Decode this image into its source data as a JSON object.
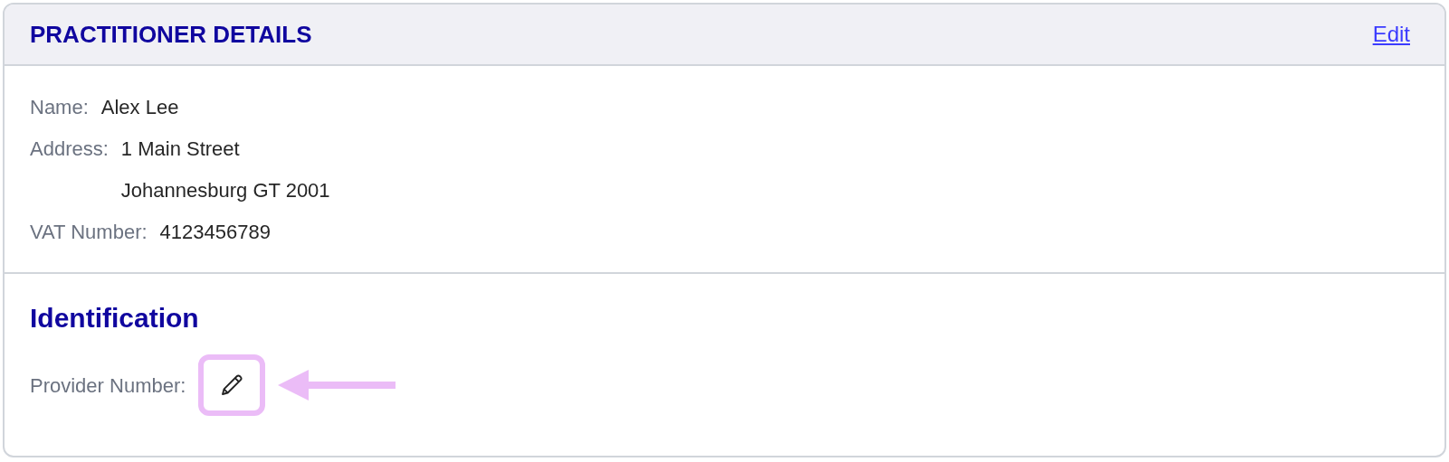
{
  "header": {
    "title": "PRACTITIONER DETAILS",
    "edit_link": "Edit"
  },
  "details": [
    {
      "label": "Name:",
      "lines": [
        "Alex Lee"
      ]
    },
    {
      "label": "Address:",
      "lines": [
        "1 Main Street",
        "Johannesburg GT 2001"
      ]
    },
    {
      "label": "VAT Number:",
      "lines": [
        "4123456789"
      ]
    }
  ],
  "identification": {
    "title": "Identification",
    "fields": [
      {
        "label": "Provider Number:",
        "highlighted": true
      }
    ]
  }
}
